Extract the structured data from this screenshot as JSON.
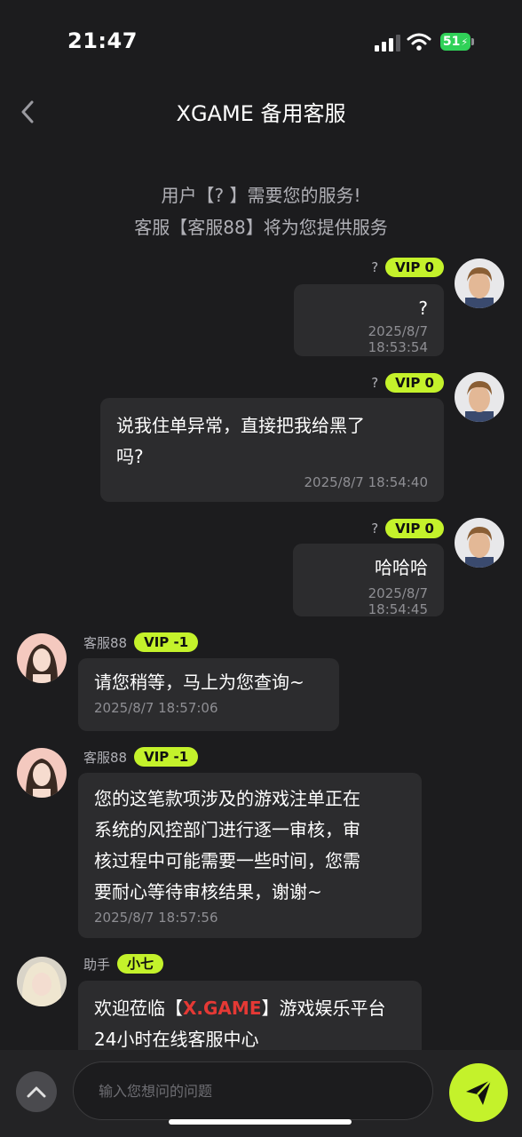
{
  "status_bar": {
    "time": "21:47",
    "battery": "51"
  },
  "header": {
    "title": "XGAME 备用客服"
  },
  "system": {
    "line1": "用户【? 】需要您的服务!",
    "line2": "客服【客服88】将为您提供服务"
  },
  "messages": [
    {
      "sender": "?",
      "vip": "VIP 0",
      "text": "?",
      "time": "2025/8/7 18:53:54"
    },
    {
      "sender": "?",
      "vip": "VIP 0",
      "line1": "说我住单异常，直接把我给黑了",
      "line2": "吗?",
      "time": "2025/8/7 18:54:40"
    },
    {
      "sender": "?",
      "vip": "VIP 0",
      "text": "哈哈哈",
      "time": "2025/8/7 18:54:45"
    },
    {
      "sender": "客服88",
      "vip": "VIP -1",
      "text": "请您稍等，马上为您查询~",
      "time": "2025/8/7 18:57:06"
    },
    {
      "sender": "客服88",
      "vip": "VIP -1",
      "line1": "您的这笔款项涉及的游戏注单正在",
      "line2": "系统的风控部门进行逐一审核，审",
      "line3": "核过程中可能需要一些时间，您需",
      "line4": "要耐心等待审核结果，谢谢~",
      "time": "2025/8/7 18:57:56"
    },
    {
      "sender": "助手",
      "vip": "小七",
      "text_pre": "欢迎莅临【",
      "text_brand": "X.GAME",
      "text_post": "】游戏娱乐平台",
      "line2": "24小时在线客服中心"
    }
  ],
  "composer": {
    "placeholder": "输入您想问的问题"
  },
  "icons": {
    "back": "chevron-left-icon",
    "expand": "chevron-up-icon",
    "send": "send-icon",
    "signal": "signal-icon",
    "wifi": "wifi-icon",
    "battery": "battery-icon"
  },
  "colors": {
    "background": "#1c1c1e",
    "bubble": "#2c2c2e",
    "accent": "#c4f22b",
    "brand_red": "#e53935"
  }
}
